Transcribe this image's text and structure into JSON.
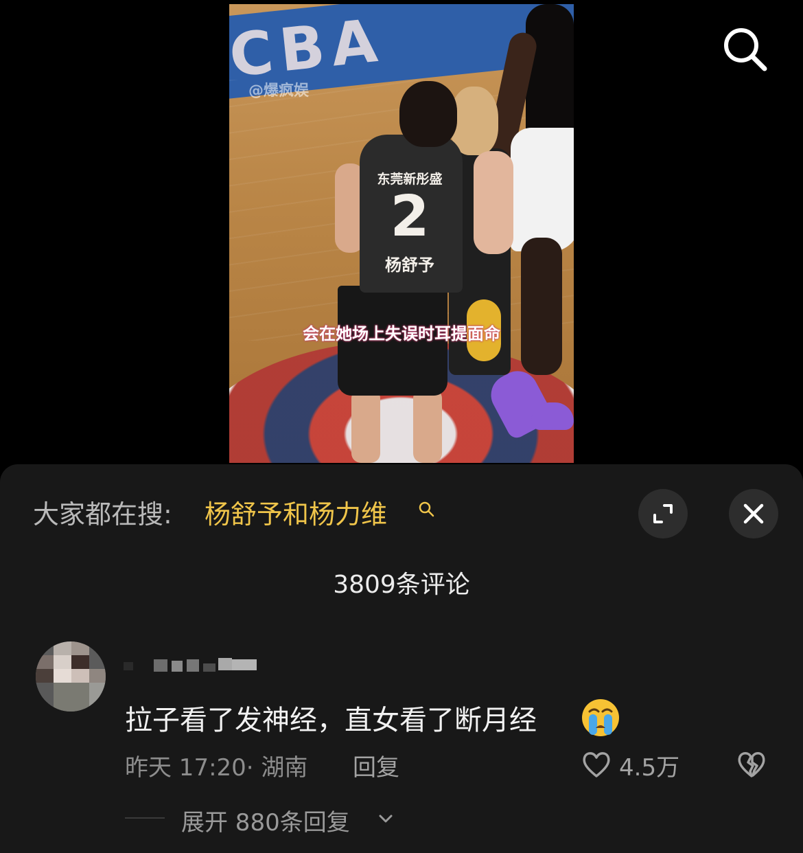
{
  "video": {
    "watermark": "@爆疯娱",
    "court_letters": "CBA",
    "jersey_team": "东莞新彤盛",
    "jersey_number": "2",
    "jersey_name": "杨舒予",
    "caption": "会在她场上失误时耳提面命"
  },
  "icons": {
    "top_search": "search-icon",
    "expand": "expand-icon",
    "close": "close-icon",
    "like": "heart-icon",
    "dislike": "broken-heart-icon",
    "emoji": "crying-face-emoji"
  },
  "sheet": {
    "search_prefix": "大家都在搜:",
    "search_term": "杨舒予和杨力维",
    "comment_count": "3809条评论"
  },
  "comment": {
    "text": "拉子看了发神经，直女看了断月经",
    "time_location": "昨天 17:20· 湖南",
    "reply_label": "回复",
    "like_count": "4.5万",
    "expand_replies": "展开 880条回复"
  },
  "colors": {
    "sheet_bg": "#181818",
    "accent_yellow": "#f0c54a",
    "muted_text": "#8d8d8d"
  }
}
